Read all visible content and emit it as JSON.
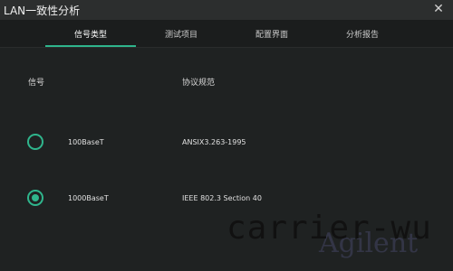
{
  "window": {
    "title": "LAN一致性分析"
  },
  "tabs": [
    {
      "label": "信号类型",
      "active": true
    },
    {
      "label": "测试项目",
      "active": false
    },
    {
      "label": "配置界面",
      "active": false
    },
    {
      "label": "分析报告",
      "active": false
    }
  ],
  "table": {
    "headers": {
      "signal": "信号",
      "standard": "协议规范"
    },
    "rows": [
      {
        "signal": "100BaseT",
        "standard": "ANSIX3.263-1995",
        "selected": false
      },
      {
        "signal": "1000BaseT",
        "standard": "IEEE 802.3 Section 40",
        "selected": true
      }
    ]
  },
  "watermark": {
    "text": "carrier-wu"
  },
  "colors": {
    "accent": "#2fb58c",
    "background": "#1f2222"
  }
}
